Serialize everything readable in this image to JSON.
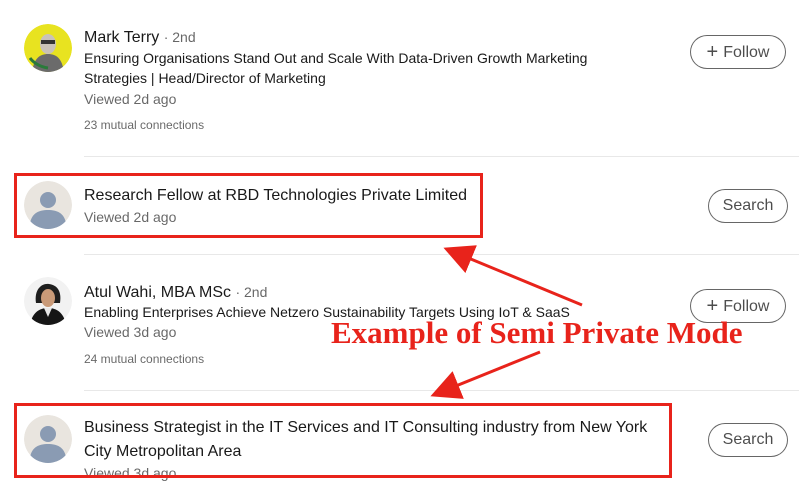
{
  "items": [
    {
      "name": "Mark Terry",
      "degree": "· 2nd",
      "headline": "Ensuring Organisations Stand Out and Scale With Data-Driven Growth Marketing Strategies | Head/Director of Marketing",
      "viewed": "Viewed 2d ago",
      "mutual": "23 mutual connections",
      "button": "Follow",
      "button_icon": "plus-icon"
    },
    {
      "title": "Research Fellow at RBD Technologies Private Limited",
      "viewed": "Viewed 2d ago",
      "button": "Search"
    },
    {
      "name": "Atul Wahi, MBA MSc",
      "degree": "· 2nd",
      "headline": "Enabling Enterprises Achieve Netzero Sustainability Targets Using IoT & SaaS",
      "viewed": "Viewed 3d ago",
      "mutual": "24 mutual connections",
      "button": "Follow",
      "button_icon": "plus-icon"
    },
    {
      "title": "Business Strategist in the IT Services and IT Consulting industry from New York City Metropolitan Area",
      "viewed": "Viewed 3d ago",
      "button": "Search"
    }
  ],
  "annotation": {
    "text": "Example of Semi Private Mode",
    "color": "#e8231b"
  },
  "colors": {
    "avatar_yellow": "#e8e320",
    "placeholder_bg": "#e9e5df",
    "placeholder_figure": "#8a9bb3"
  }
}
